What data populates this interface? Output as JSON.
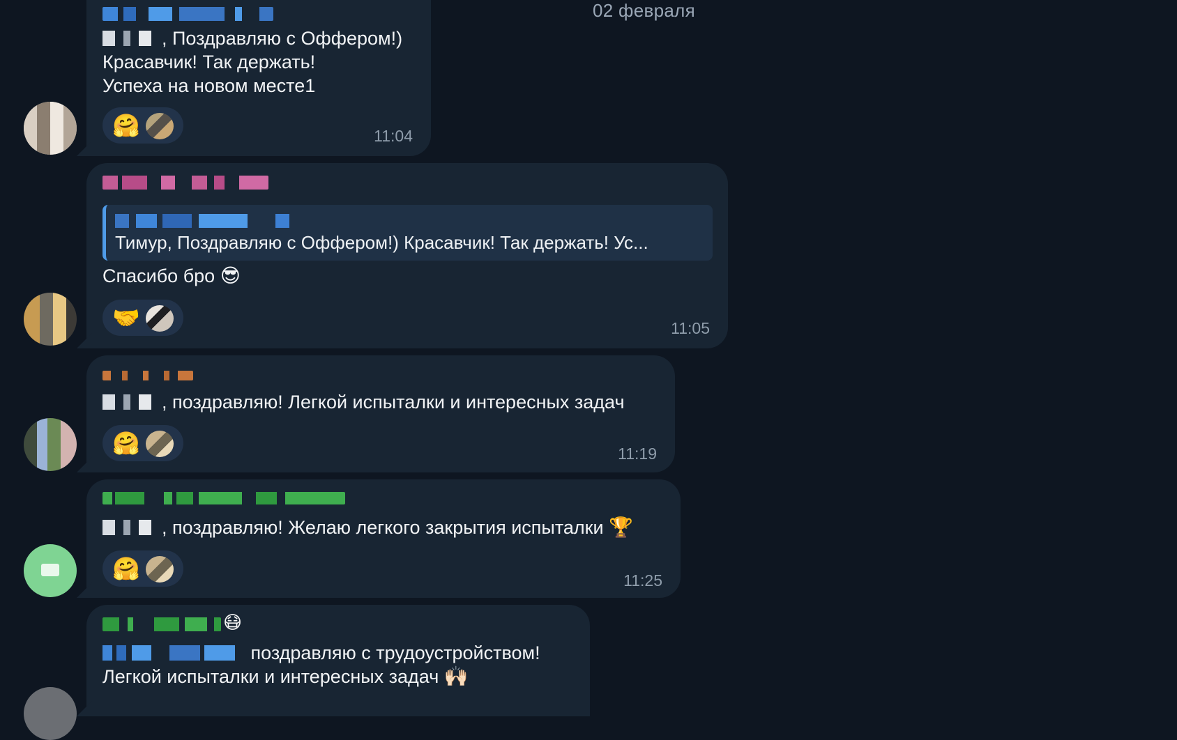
{
  "date_separator": "02 февраля",
  "messages": [
    {
      "text_prefix": ", ",
      "text": "Поздравляю с Оффером!)\nКрасавчик! Так держать!\nУспеха на новом месте1",
      "reaction_emoji": "🤗",
      "time": "11:04"
    },
    {
      "reply_text": "Тимур, Поздравляю с Оффером!) Красавчик! Так держать! Ус...",
      "text": "Спасибо бро",
      "text_emoji": "😎",
      "reaction_emoji": "🤝",
      "time": "11:05"
    },
    {
      "text": ", поздравляю! Легкой испыталки и интересных задач",
      "reaction_emoji": "🤗",
      "time": "11:19"
    },
    {
      "text": ", поздравляю! Желаю легкого закрытия испыталки",
      "text_emoji": "🏆",
      "reaction_emoji": "🤗",
      "time": "11:25"
    },
    {
      "sender_emoji": "😷",
      "text": "поздравляю с трудоустройством!\nЛегкой испыталки и интересных задач",
      "text_emoji": "🙌🏻"
    }
  ],
  "colors": {
    "background": "#0e1621",
    "bubble": "#182533",
    "reaction_pill": "#22334a",
    "reply_accent": "#4f9be8",
    "time": "#8f9dab"
  }
}
